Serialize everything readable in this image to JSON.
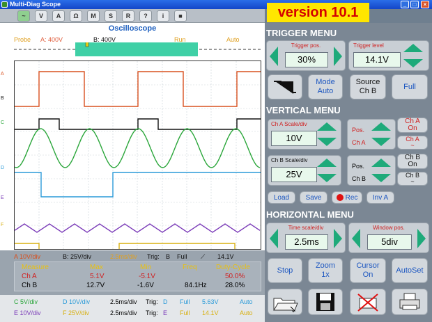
{
  "window": {
    "title": "Multi-Diag Scope"
  },
  "version": "version 10.1",
  "toolbar": {
    "tools": [
      "~",
      "V",
      "A",
      "Ω",
      "M",
      "S",
      "R",
      "?",
      "i",
      "■"
    ]
  },
  "scope": {
    "title": "Oscilloscope",
    "probe": "Probe",
    "ch_a_label": "A: 400V",
    "ch_b_label": "B: 400V",
    "run": "Run",
    "auto": "Auto",
    "channel_markers": [
      "A",
      "B",
      "C",
      "D",
      "E",
      "F"
    ]
  },
  "status": {
    "a_div": "A 10V/div",
    "b_div": "B: 25V/div",
    "time_div": "2.5ms/div",
    "trig_label": "Trig:",
    "trig_ch": "B",
    "trig_mode": "Full",
    "trig_level": "14.1V"
  },
  "measure": {
    "headers": [
      "Measure",
      "Max",
      "Min",
      "Freq",
      "Duty-Cycle"
    ],
    "rows": [
      [
        "Ch A",
        "5.1V",
        "-5.1V",
        "",
        "50.0%"
      ],
      [
        "Ch B",
        "12.7V",
        "-1.6V",
        "84.1Hz",
        "28.0%"
      ]
    ]
  },
  "extra1": {
    "c": "C 5V/div",
    "d": "D 10V/div",
    "time": "2.5ms/div",
    "trig": "Trig:",
    "ch": "D",
    "mode": "Full",
    "level": "5.63V",
    "auto": "Auto"
  },
  "extra2": {
    "e": "E 10V/div",
    "f": "F 25V/div",
    "time": "2.5ms/div",
    "trig": "Trig:",
    "ch": "E",
    "mode": "Full",
    "level": "14.1V",
    "auto": "Auto"
  },
  "trigger": {
    "title": "TRIGGER MENU",
    "pos_label": "Trigger pos.",
    "pos": "30%",
    "level_label": "Trigger level",
    "level": "14.1V",
    "mode_btn": [
      "Mode",
      "Auto"
    ],
    "source_btn": [
      "Source",
      "Ch B"
    ],
    "full_btn": "Full"
  },
  "vertical": {
    "title": "VERTICAL MENU",
    "cha_label": "Ch A Scale/div",
    "cha": "10V",
    "chb_label": "Ch B Scale/div",
    "chb": "25V",
    "pos_a": "Pos.",
    "cha_name": "Ch A",
    "pos_b": "Pos.",
    "chb_name": "Ch B",
    "cha_on": [
      "Ch A",
      "On"
    ],
    "cha_coupling": [
      "Ch A",
      "~"
    ],
    "chb_on": [
      "Ch B",
      "On"
    ],
    "chb_coupling": [
      "Ch B",
      "~"
    ]
  },
  "files": {
    "load": "Load",
    "save": "Save",
    "rec": "Rec",
    "inv": "Inv A"
  },
  "horizontal": {
    "title": "HORIZONTAL MENU",
    "time_label": "Time scale/div",
    "time": "2.5ms",
    "window_label": "Window pos.",
    "window": "5div"
  },
  "actions": {
    "stop": "Stop",
    "zoom": [
      "Zoom",
      "1x"
    ],
    "cursor": [
      "Cursor",
      "On"
    ],
    "autoset": "AutoSet"
  },
  "colors": {
    "ch_a": "#d8501e",
    "ch_b": "#111111",
    "ch_c": "#2aa63a",
    "ch_d": "#2a9ad8",
    "ch_e": "#7a3ab8",
    "ch_f": "#d8b010",
    "accent": "#1eaa7a"
  }
}
